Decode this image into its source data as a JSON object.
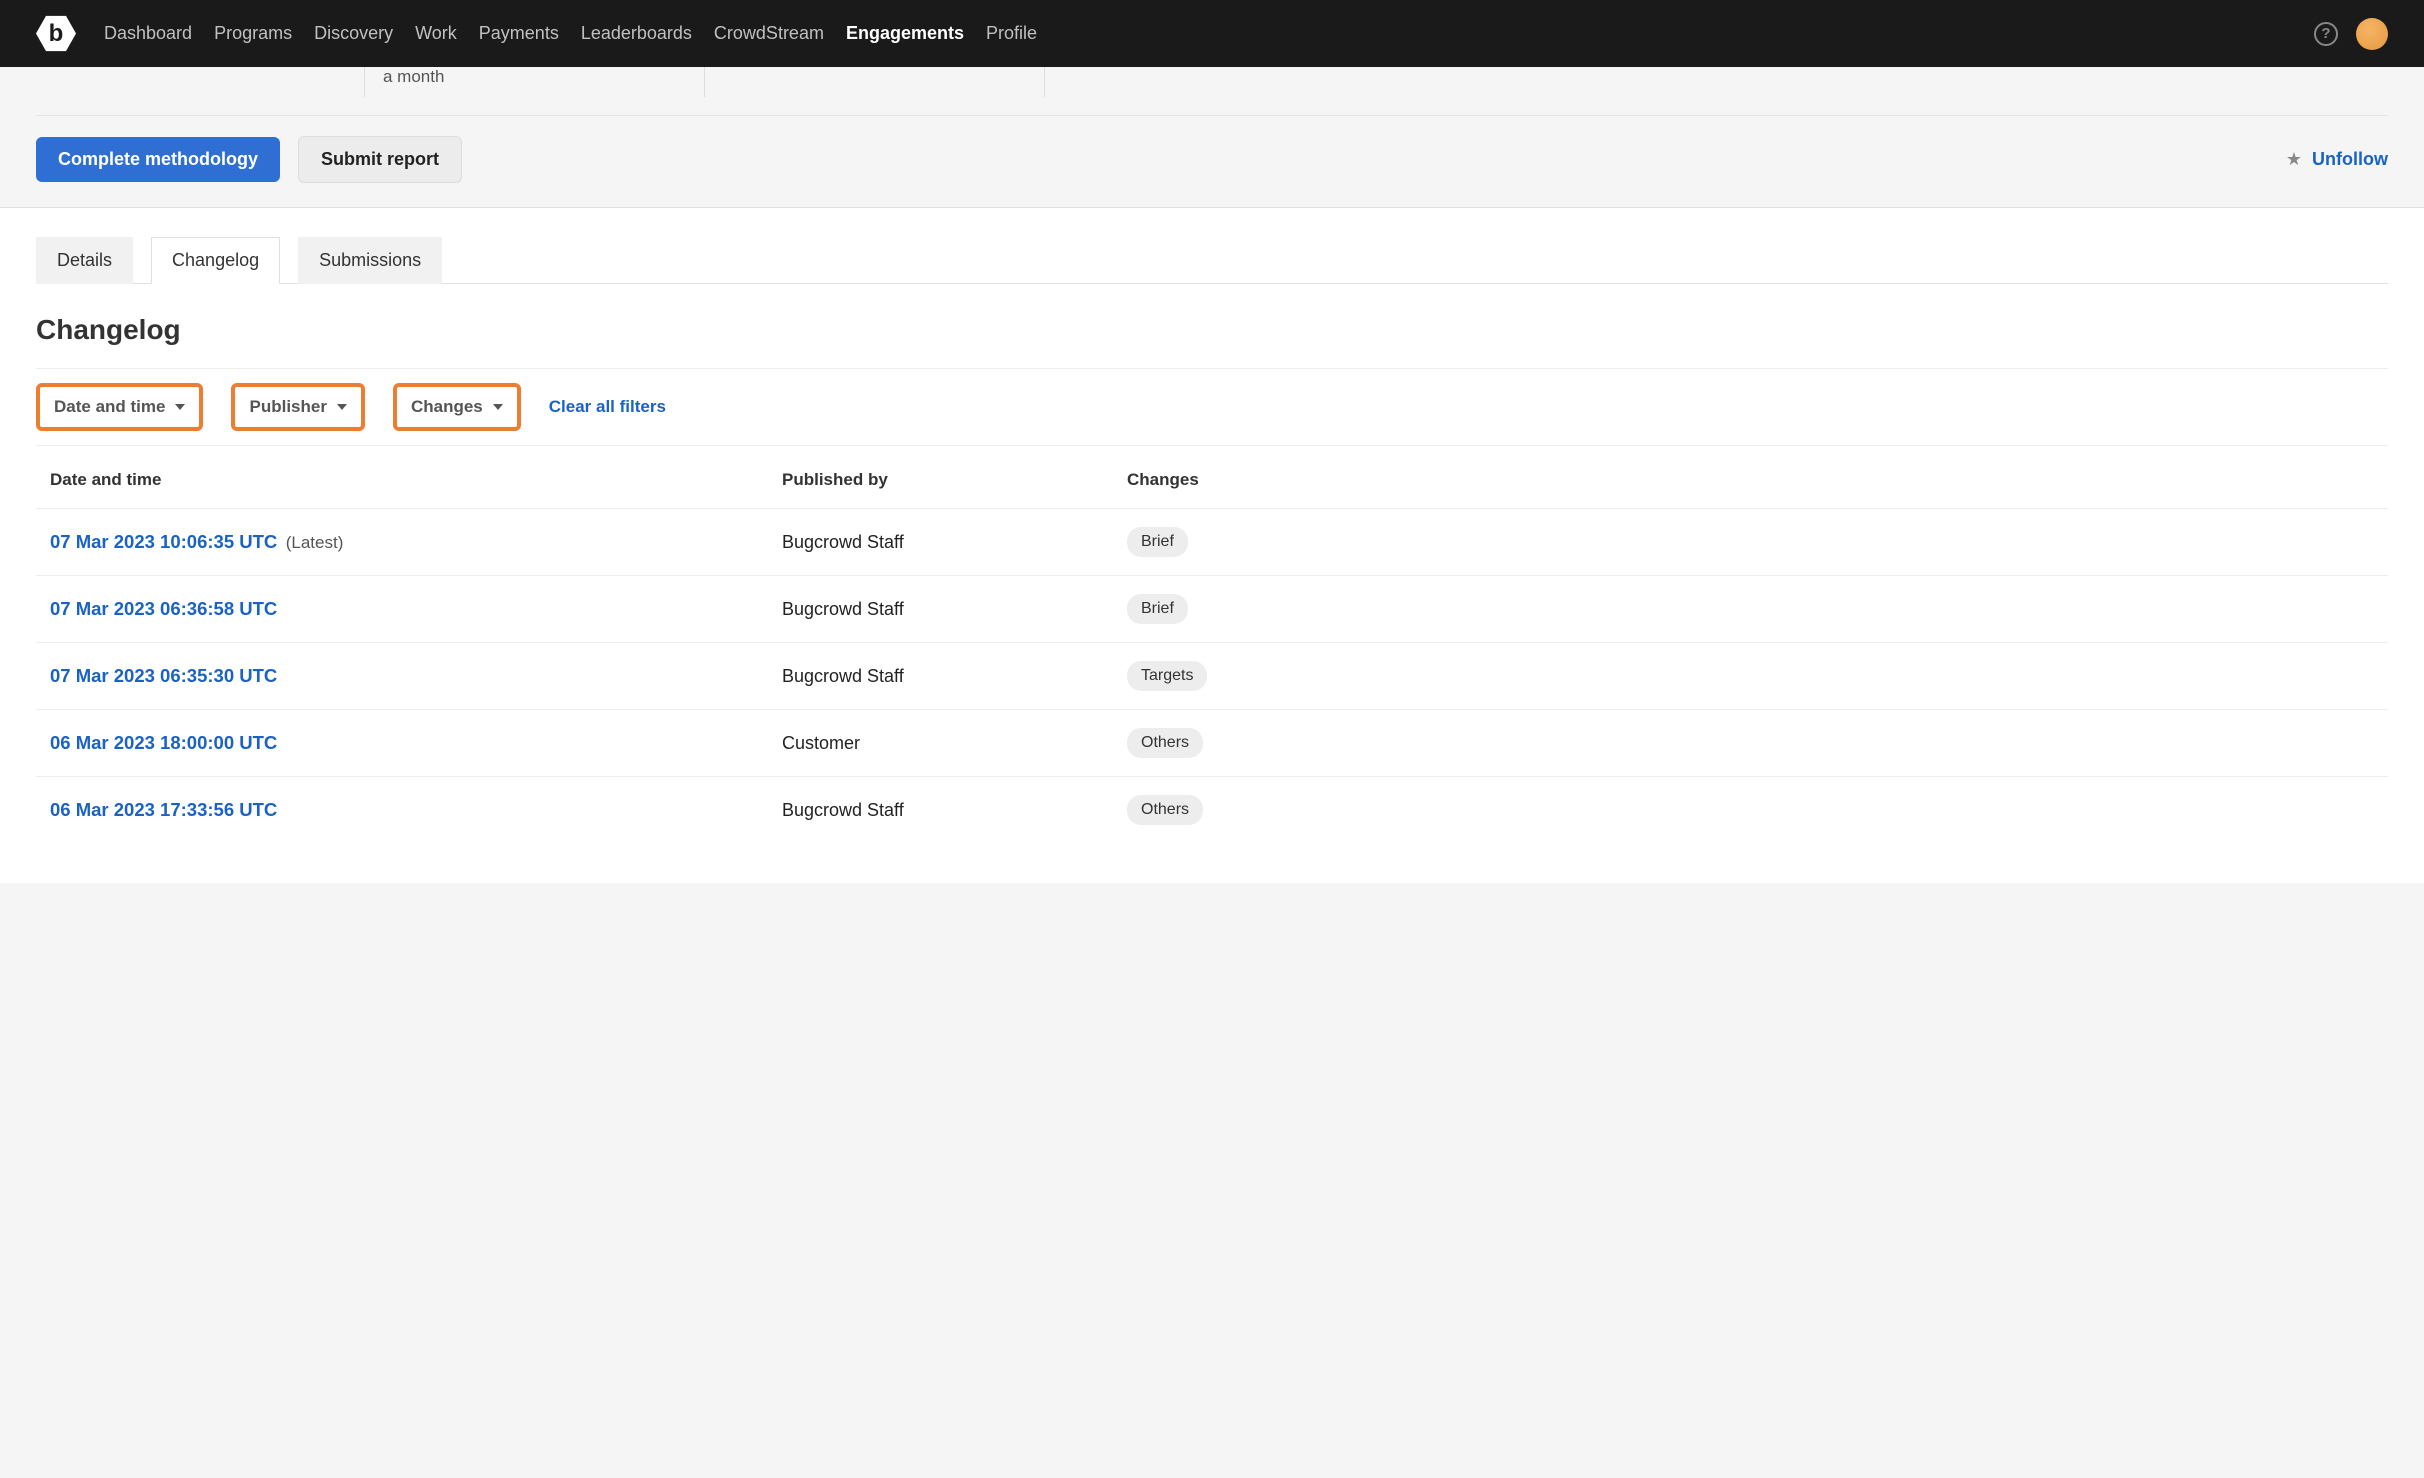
{
  "nav": {
    "items": [
      {
        "label": "Dashboard"
      },
      {
        "label": "Programs"
      },
      {
        "label": "Discovery"
      },
      {
        "label": "Work"
      },
      {
        "label": "Payments"
      },
      {
        "label": "Leaderboards"
      },
      {
        "label": "CrowdStream"
      },
      {
        "label": "Engagements",
        "active": true
      },
      {
        "label": "Profile"
      }
    ],
    "logo_letter": "b"
  },
  "info": {
    "snippet": "a month"
  },
  "actions": {
    "complete_methodology": "Complete methodology",
    "submit_report": "Submit report",
    "unfollow": "Unfollow"
  },
  "tabs": [
    {
      "label": "Details"
    },
    {
      "label": "Changelog",
      "active": true
    },
    {
      "label": "Submissions"
    }
  ],
  "page_title": "Changelog",
  "filters": {
    "date_time": "Date and time",
    "publisher": "Publisher",
    "changes": "Changes",
    "clear": "Clear all filters"
  },
  "table": {
    "headers": {
      "date": "Date and time",
      "publisher": "Published by",
      "changes": "Changes"
    },
    "rows": [
      {
        "date": "07 Mar 2023 10:06:35 UTC",
        "latest": "(Latest)",
        "publisher": "Bugcrowd Staff",
        "change": "Brief"
      },
      {
        "date": "07 Mar 2023 06:36:58 UTC",
        "latest": "",
        "publisher": "Bugcrowd Staff",
        "change": "Brief"
      },
      {
        "date": "07 Mar 2023 06:35:30 UTC",
        "latest": "",
        "publisher": "Bugcrowd Staff",
        "change": "Targets"
      },
      {
        "date": "06 Mar 2023 18:00:00 UTC",
        "latest": "",
        "publisher": "Customer",
        "change": "Others"
      },
      {
        "date": "06 Mar 2023 17:33:56 UTC",
        "latest": "",
        "publisher": "Bugcrowd Staff",
        "change": "Others"
      }
    ]
  }
}
